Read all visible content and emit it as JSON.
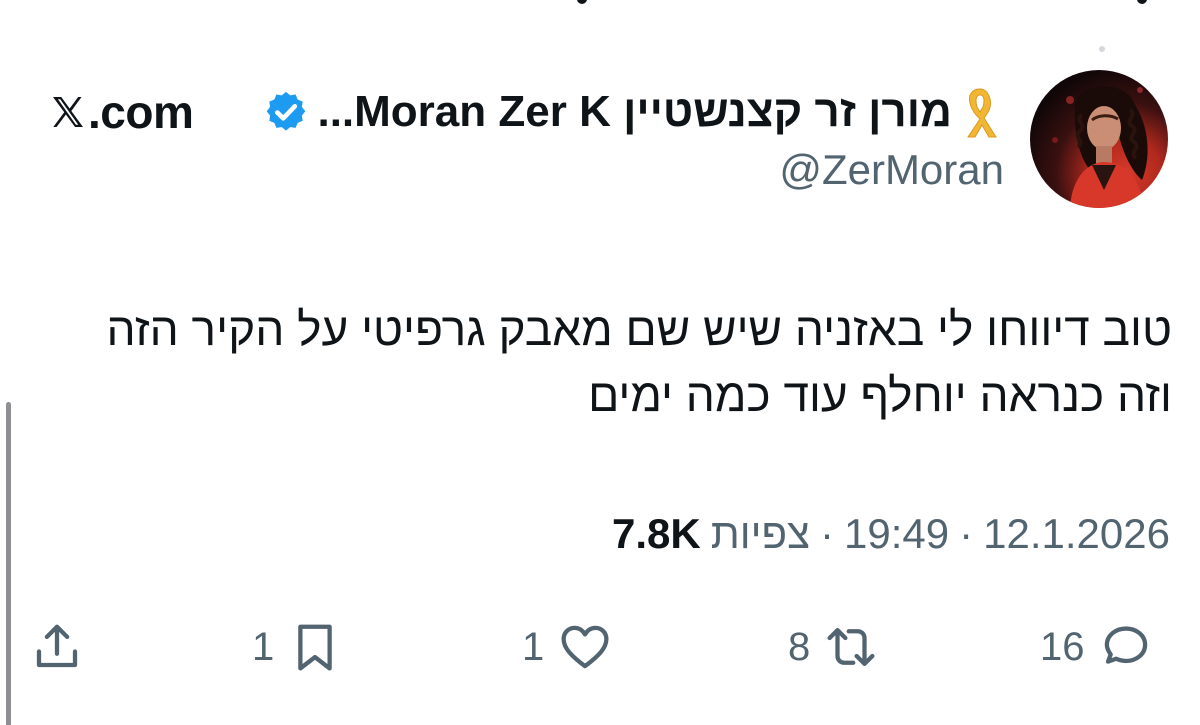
{
  "tweet": {
    "display_name": "מורן זר קצנשטיין Moran Zer K...",
    "handle": "@ZerMoran",
    "source": ".com",
    "text_lines": [
      "טוב דיווחו לי באזניה שיש שם מאבק גרפיטי על הקיר הזה",
      "וזה כנראה יוחלף עוד כמה ימים"
    ],
    "date": "12.1.2026",
    "time": "19:49",
    "views_label": "צפיות",
    "views_count": "7.8K",
    "separator": "·"
  },
  "actions": {
    "replies": "16",
    "reposts": "8",
    "likes": "1",
    "bookmarks": "1"
  },
  "icons": {
    "verified": "verified-badge-icon",
    "ribbon": "yellow-ribbon-icon",
    "x_logo": "x-logo-icon",
    "reply": "reply-icon",
    "repost": "repost-icon",
    "like": "heart-icon",
    "bookmark": "bookmark-icon",
    "share": "share-icon"
  },
  "colors": {
    "verified_blue": "#1d9bf0",
    "ribbon_yellow": "#f2b635",
    "muted_text": "#536471",
    "primary_text": "#0f1419"
  }
}
